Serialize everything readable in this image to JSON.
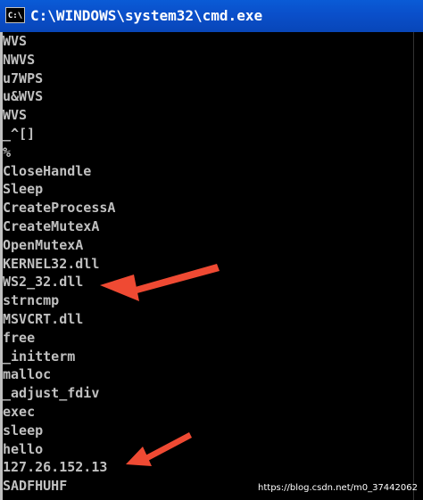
{
  "window": {
    "title": "C:\\WINDOWS\\system32\\cmd.exe",
    "icon_label": "C:\\"
  },
  "console": {
    "lines": [
      "WVS",
      "NWVS",
      "u7WPS",
      "u&WVS",
      "WVS",
      "_^[]",
      "%",
      "CloseHandle",
      "Sleep",
      "CreateProcessA",
      "CreateMutexA",
      "OpenMutexA",
      "KERNEL32.dll",
      "WS2_32.dll",
      "strncmp",
      "MSVCRT.dll",
      "free",
      "_initterm",
      "malloc",
      "_adjust_fdiv",
      "exec",
      "sleep",
      "hello",
      "127.26.152.13",
      "SADFHUHF"
    ]
  },
  "watermark": "https://blog.csdn.net/m0_37442062",
  "colors": {
    "titlebar": "#0a4fca",
    "console_bg": "#000000",
    "console_text": "#c0c0c0",
    "annotation_arrow": "#ef4a33"
  }
}
